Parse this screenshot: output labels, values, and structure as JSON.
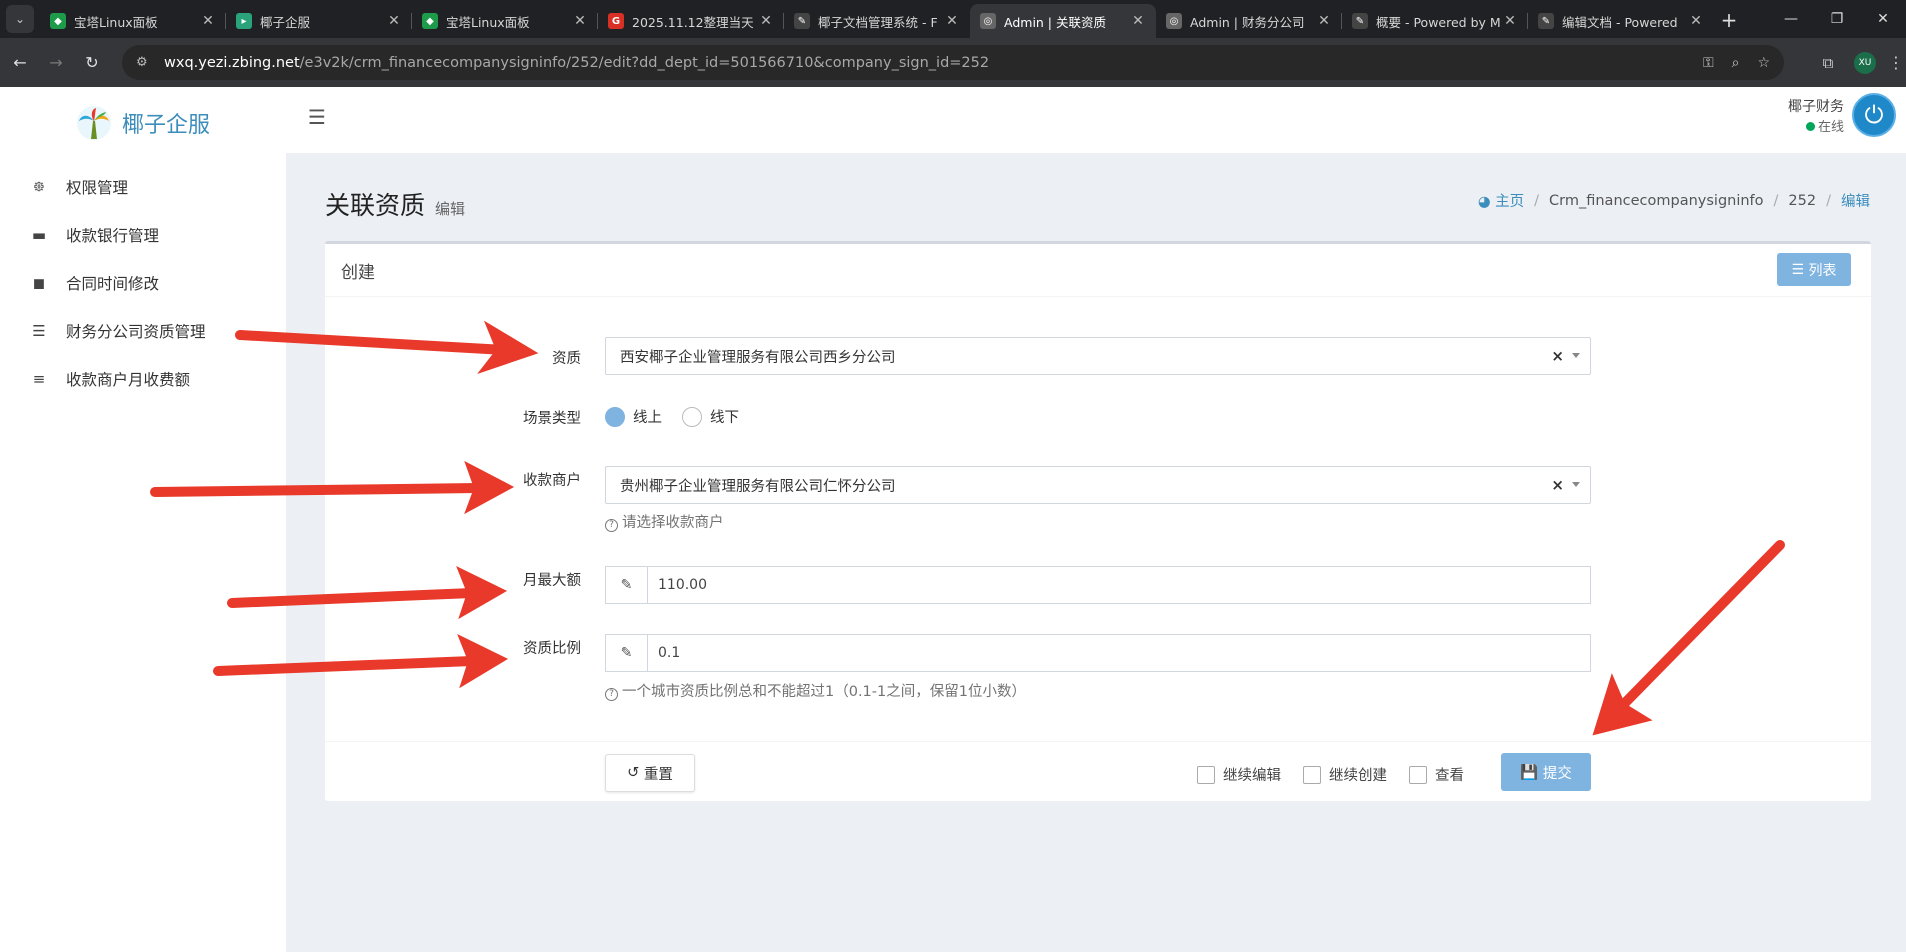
{
  "browser": {
    "tabs": [
      {
        "title": "宝塔Linux面板",
        "fav_color": "#1d9a4a",
        "fav": "◆"
      },
      {
        "title": "椰子企服",
        "fav_color": "#2aa37a",
        "fav": "▸"
      },
      {
        "title": "宝塔Linux面板",
        "fav_color": "#1d9a4a",
        "fav": "◆"
      },
      {
        "title": "2025.11.12整理当天",
        "fav_color": "#d93025",
        "fav": "G"
      },
      {
        "title": "椰子文档管理系统 - F",
        "fav_color": "#444",
        "fav": "✎"
      },
      {
        "title": "Admin | 关联资质",
        "fav_color": "#666",
        "fav": "◎"
      },
      {
        "title": "Admin | 财务分公司",
        "fav_color": "#666",
        "fav": "◎"
      },
      {
        "title": "概要 - Powered by M",
        "fav_color": "#444",
        "fav": "✎"
      },
      {
        "title": "编辑文档 - Powered",
        "fav_color": "#444",
        "fav": "✎"
      }
    ],
    "url_host": "wxq.yezi.zbing.net",
    "url_rest": "/e3v2k/crm_financecompanysigninfo/252/edit?dd_dept_id=501566710&company_sign_id=252",
    "profile": "XU"
  },
  "sidebar": {
    "brand": "椰子企服",
    "items": [
      {
        "label": "权限管理",
        "icon": "fingerprint-icon"
      },
      {
        "label": "收款银行管理",
        "icon": "bank-card-icon"
      },
      {
        "label": "合同时间修改",
        "icon": "sticky-note-icon"
      },
      {
        "label": "财务分公司资质管理",
        "icon": "list-icon"
      },
      {
        "label": "收款商户月收费额",
        "icon": "align-center-icon"
      }
    ]
  },
  "topnav": {
    "user_name": "椰子财务",
    "user_status": "在线"
  },
  "header": {
    "title": "关联资质",
    "subtitle": "编辑",
    "breadcrumb": {
      "home": "主页",
      "crumbs": [
        "Crm_financecompanysigninfo",
        "252"
      ],
      "current": "编辑"
    }
  },
  "form": {
    "title": "创建",
    "list_button": "列表",
    "fields": {
      "qualification": {
        "label": "资质",
        "value": "西安椰子企业管理服务有限公司西乡分公司"
      },
      "scene_type": {
        "label": "场景类型",
        "options": [
          "线上",
          "线下"
        ],
        "selected": "线上"
      },
      "merchant": {
        "label": "收款商户",
        "value": "贵州椰子企业管理服务有限公司仁怀分公司",
        "help": "请选择收款商户"
      },
      "monthly_max": {
        "label": "月最大额",
        "value": "110.00"
      },
      "ratio": {
        "label": "资质比例",
        "value": "0.1",
        "help": "一个城市资质比例总和不能超过1（0.1-1之间，保留1位小数）"
      }
    },
    "footer": {
      "reset": "重置",
      "continue_edit": "继续编辑",
      "continue_create": "继续创建",
      "view": "查看",
      "submit": "提交"
    }
  },
  "colors": {
    "accent": "#3c8dbc",
    "button": "#7fb3e0",
    "annotation_arrow": "#e8392a"
  }
}
